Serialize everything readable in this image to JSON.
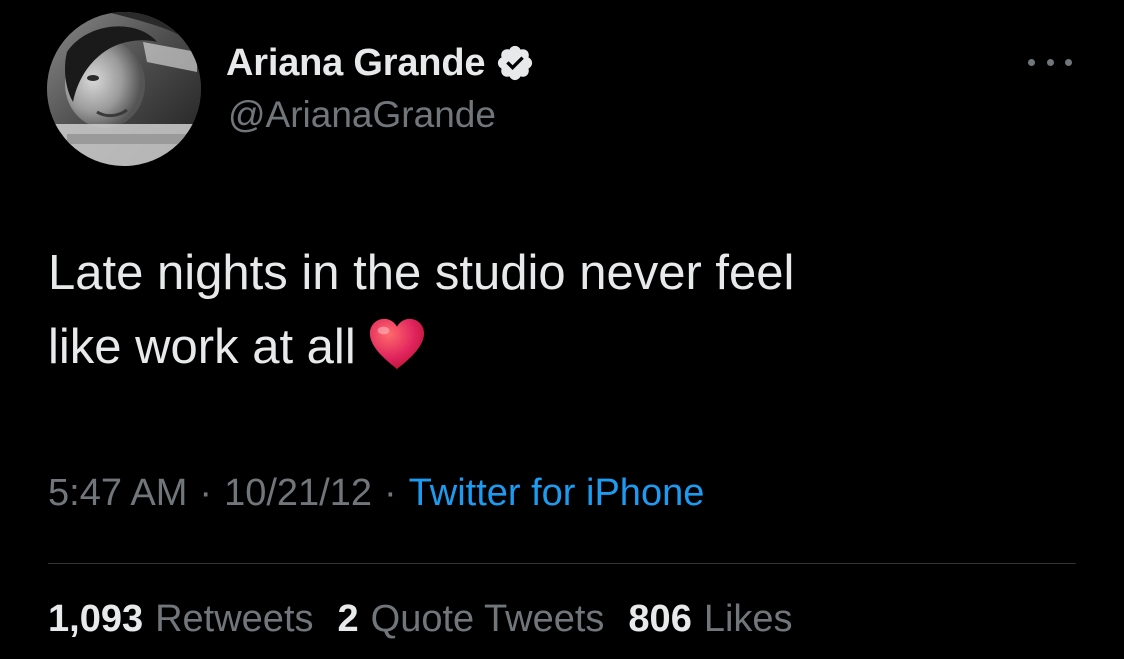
{
  "author": {
    "display_name": "Ariana Grande",
    "handle": "@ArianaGrande",
    "verified_icon": "verified-badge-icon",
    "avatar_icon": "profile-photo"
  },
  "tweet": {
    "text_line1": "Late nights in the studio never feel",
    "text_line2": "like work at all",
    "emoji_icon": "red-heart-emoji"
  },
  "meta": {
    "time": "5:47 AM",
    "separator": "·",
    "date": "10/21/12",
    "source": "Twitter for iPhone"
  },
  "stats": {
    "retweets_count": "1,093",
    "retweets_label": "Retweets",
    "quotes_count": "2",
    "quotes_label": "Quote Tweets",
    "likes_count": "806",
    "likes_label": "Likes"
  },
  "colors": {
    "background": "#000000",
    "primary_text": "#e7e9ea",
    "secondary_text": "#71767b",
    "link": "#1d9bf0",
    "divider": "#2f3336",
    "heart": "#e0245e"
  },
  "more_icon": "more-options-icon"
}
